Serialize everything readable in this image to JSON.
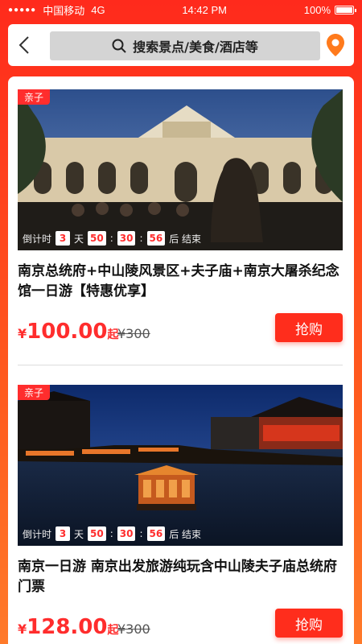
{
  "status_bar": {
    "carrier": "中国移动",
    "network": "4G",
    "time": "14:42 PM",
    "battery": "100%"
  },
  "header": {
    "search_placeholder": "搜索景点/美食/酒店等",
    "icons": [
      "back-icon",
      "search-icon",
      "location-pin-icon"
    ]
  },
  "products": [
    {
      "tag": "亲子",
      "countdown": {
        "label": "倒计时",
        "days": "3",
        "day_unit": "天",
        "hours": "50",
        "minutes": "30",
        "seconds": "56",
        "sep": ":",
        "end_label": "后 结束"
      },
      "title": "南京总统府+中山陵风景区+夫子庙+南京大屠杀纪念馆一日游【特惠优享】",
      "price": {
        "symbol": "¥",
        "value": "100.00",
        "suffix": "起"
      },
      "original_price": "¥300",
      "buy_label": "抢购"
    },
    {
      "tag": "亲子",
      "countdown": {
        "label": "倒计时",
        "days": "3",
        "day_unit": "天",
        "hours": "50",
        "minutes": "30",
        "seconds": "56",
        "sep": ":",
        "end_label": "后 结束"
      },
      "title": "南京一日游 南京出发旅游纯玩含中山陵夫子庙总统府门票",
      "price": {
        "symbol": "¥",
        "value": "128.00",
        "suffix": "起"
      },
      "original_price": "¥300",
      "buy_label": "抢购"
    }
  ],
  "colors": {
    "accent": "#ff2d2d",
    "gradient_top": "#ff2a1c",
    "gradient_bottom": "#ff7a2a",
    "pin": "#ff7a1c"
  }
}
